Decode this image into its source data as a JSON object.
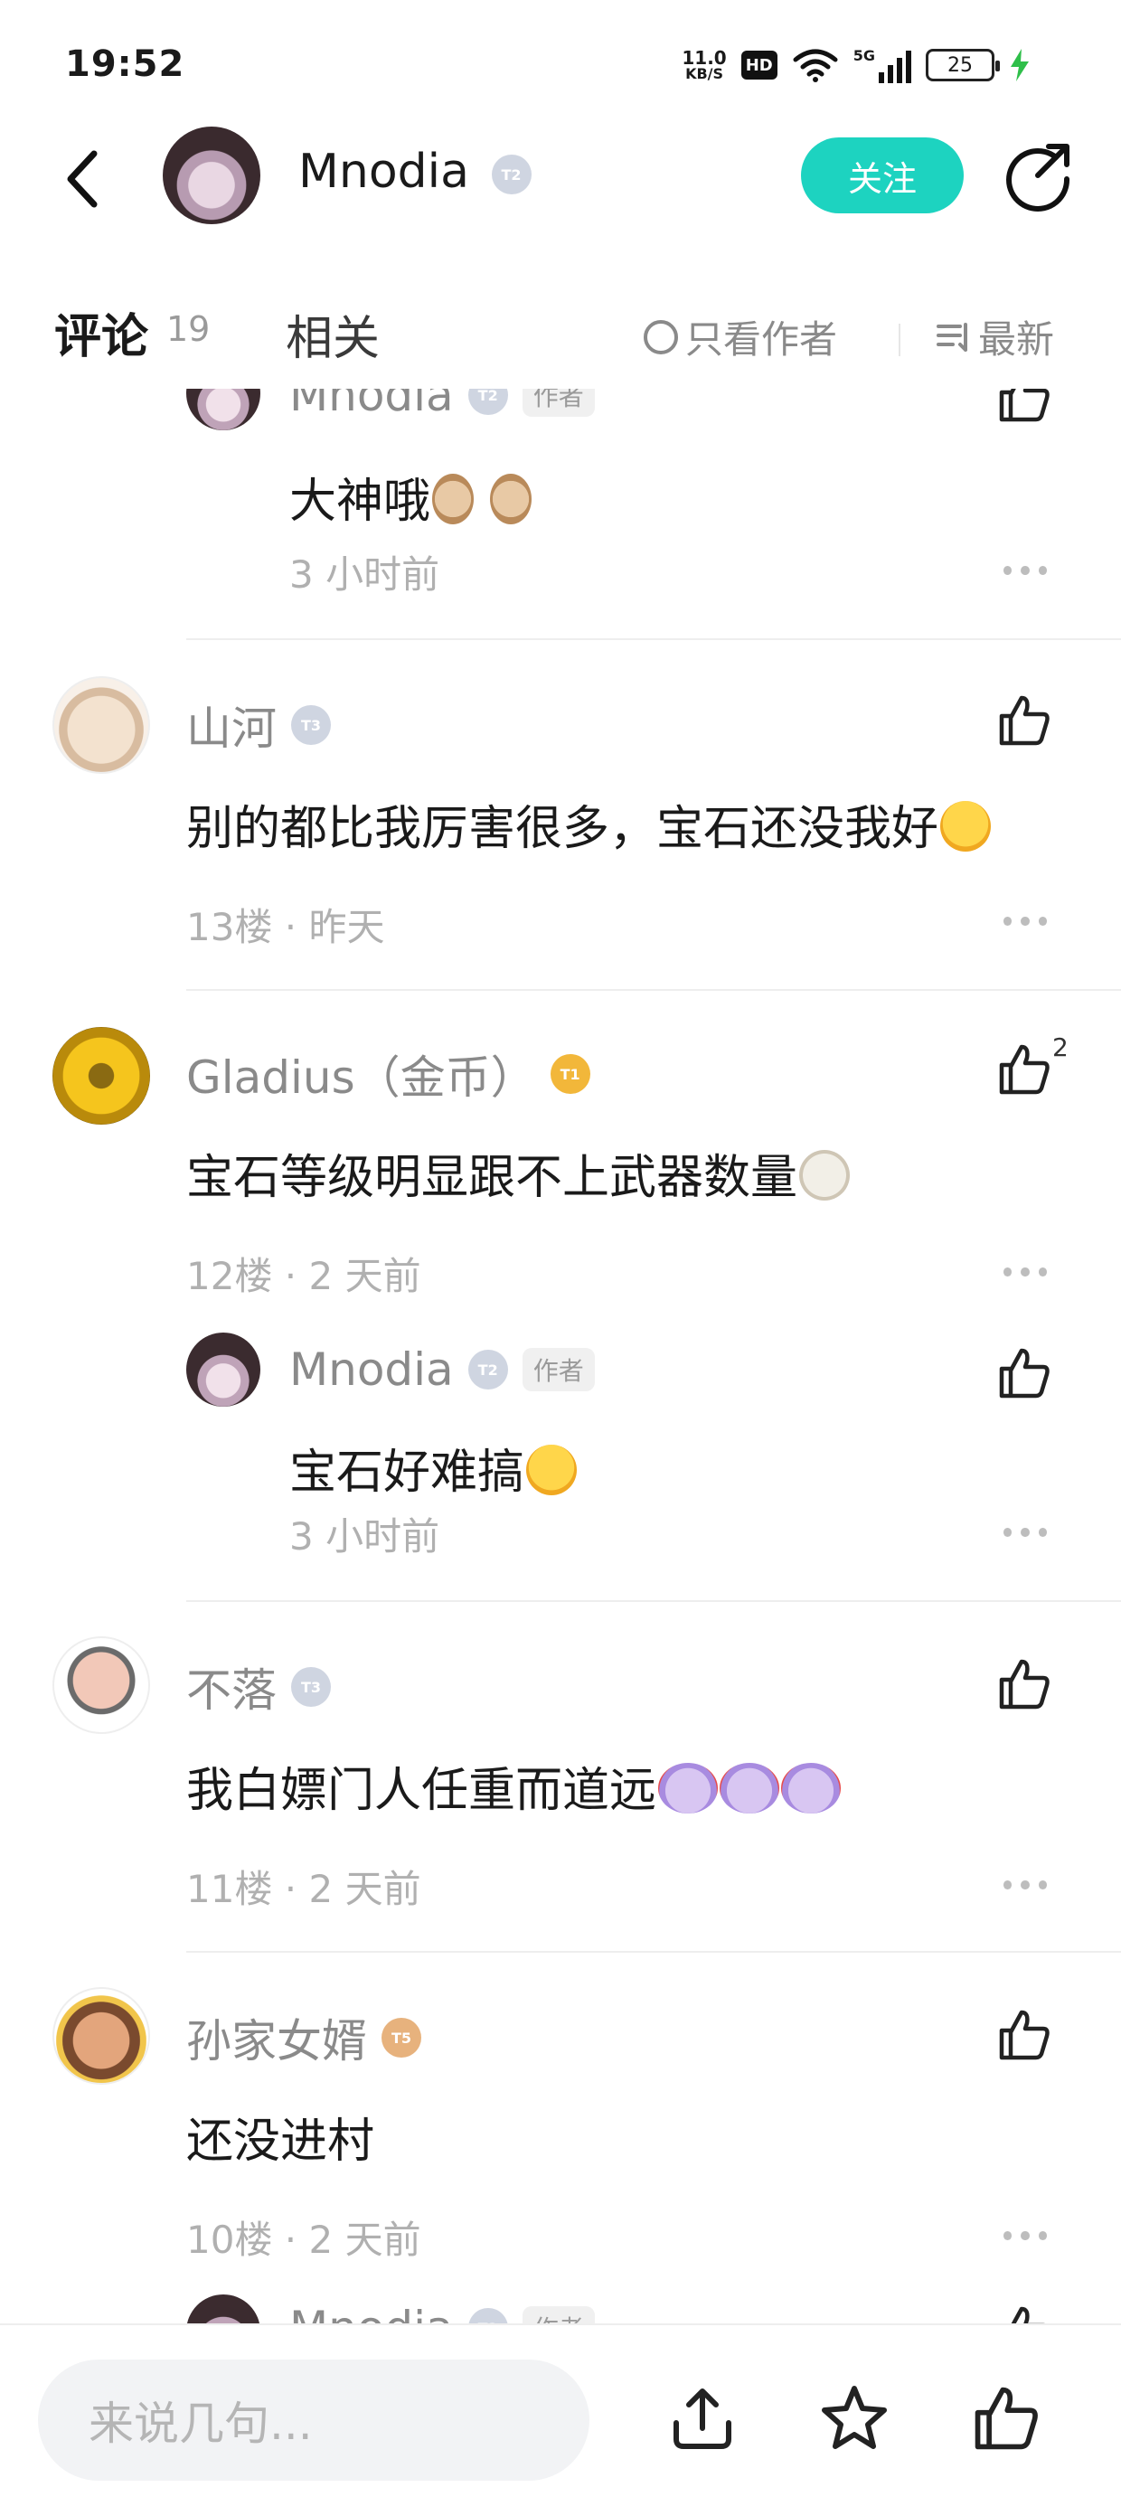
{
  "status_bar": {
    "time": "19:52",
    "net_speed_value": "11.0",
    "net_speed_unit": "KB/S",
    "hd": "HD",
    "signal": "5G",
    "battery": "25"
  },
  "header": {
    "title": "Mnodia",
    "level": "T2",
    "follow_label": "关注",
    "icons": {
      "back": "back-arrow-icon",
      "share": "share-icon"
    }
  },
  "tabs": {
    "comments_label": "评论",
    "comments_count": "19",
    "related_label": "相关",
    "author_only_label": "只看作者",
    "sort_label": "最新"
  },
  "colors": {
    "accent": "#1dd3c0",
    "meta": "#b0b0b0",
    "name": "#8a8a8a"
  },
  "comments": [
    {
      "name": "Mnodia",
      "level": "T2",
      "author_tag": "作者",
      "text": "大神哦",
      "emoji": [
        "thumbs-up",
        "thumbs-up"
      ],
      "meta": "3 小时前",
      "is_reply": true
    },
    {
      "name": "山河",
      "level": "T3",
      "text": "别的都比我厉害很多，宝石还没我好",
      "emoji": [
        "crying"
      ],
      "meta": "13楼 · 昨天"
    },
    {
      "name": "Gladius（金币）",
      "level": "T1",
      "text": "宝石等级明显跟不上武器数量",
      "emoji": [
        "cat"
      ],
      "meta": "12楼 · 2 天前",
      "like_count": "2",
      "reply": {
        "name": "Mnodia",
        "level": "T2",
        "author_tag": "作者",
        "text": "宝石好难搞",
        "emoji": [
          "crying"
        ],
        "meta": "3 小时前"
      }
    },
    {
      "name": "不落",
      "level": "T3",
      "text": "我白嫖门人任重而道远",
      "emoji": [
        "ghost",
        "ghost",
        "ghost"
      ],
      "meta": "11楼 · 2 天前"
    },
    {
      "name": "孙家女婿",
      "level": "T5",
      "text": "还没进村",
      "meta": "10楼 · 2 天前"
    },
    {
      "name": "Mnodia",
      "level": "T2",
      "author_tag": "作者",
      "is_reply": true
    }
  ],
  "bottom_bar": {
    "input_placeholder": "来说几句...",
    "icons": [
      "upload-icon",
      "star-icon",
      "thumbs-up-icon"
    ]
  }
}
